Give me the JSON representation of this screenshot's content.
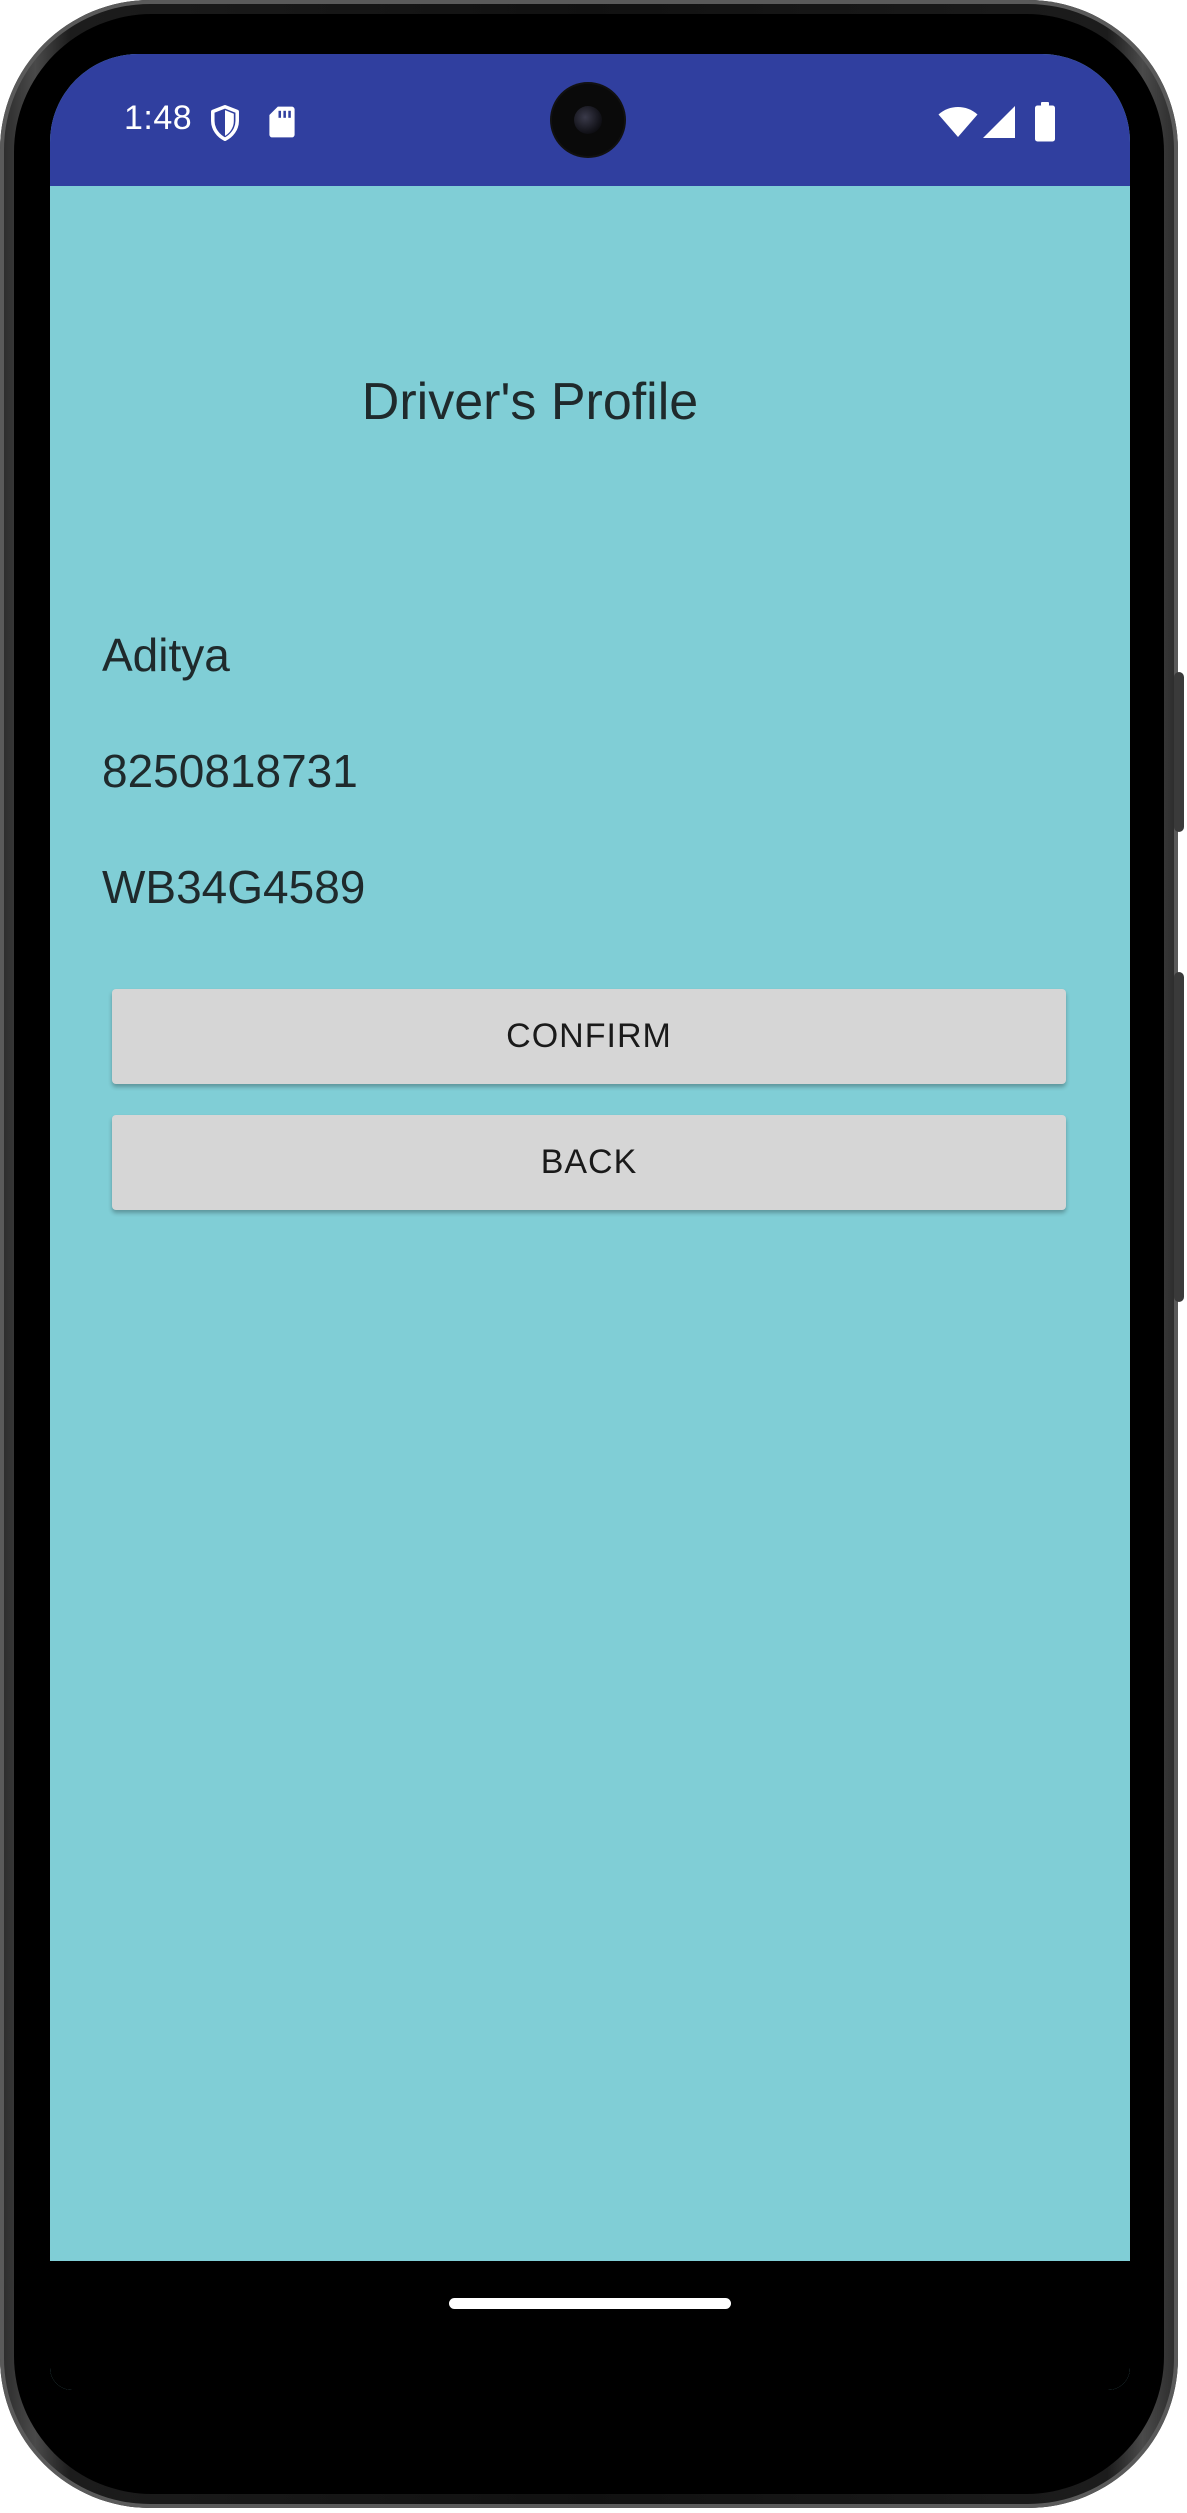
{
  "status_bar": {
    "time": "1:48",
    "color": "#303f9f",
    "left_icons": [
      "shield-icon",
      "sd-card-icon"
    ],
    "right_icons": [
      "wifi-icon",
      "cellular-signal-icon",
      "battery-icon"
    ]
  },
  "screen": {
    "background": "#80ced6",
    "title": "Driver's Profile"
  },
  "driver": {
    "name": "Aditya",
    "phone": "8250818731",
    "vehicle_number": "WB34G4589"
  },
  "actions": {
    "confirm_label": "CONFIRM",
    "back_label": "BACK"
  },
  "nav_bar": {
    "handle_icon": "home-gesture-handle"
  }
}
